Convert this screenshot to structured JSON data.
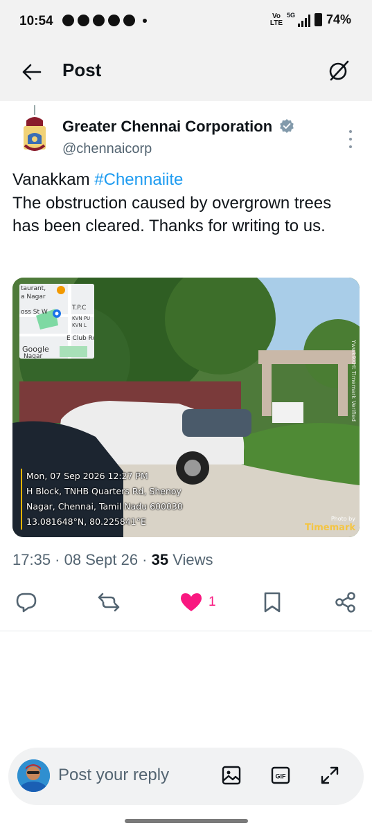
{
  "status_bar": {
    "time": "10:54",
    "network_label": "Vo LTE",
    "signal_label": "5G",
    "battery": "74%",
    "app_icons": [
      "whatsapp-icon",
      "facebook-icon",
      "facebook-icon",
      "facebook-icon",
      "messenger-icon",
      "dot-icon"
    ]
  },
  "header": {
    "title": "Post",
    "back_icon": "arrow-left-icon",
    "grok_icon": "grok-icon"
  },
  "author": {
    "name": "Greater Chennai Corporation",
    "handle": "@chennaicorp",
    "verified_icon": "verified-badge-icon",
    "more_icon": "more-vertical-icon"
  },
  "tweet": {
    "greeting": "Vanakkam ",
    "hashtag": "#Chennaiite",
    "body": "The obstruction caused by overgrown trees has been cleared. Thanks for writing to us."
  },
  "photo": {
    "map": {
      "labels": [
        "taurant,",
        "a Nagar",
        "T.P.C",
        "oss St W",
        "KVN PU",
        "KVN L",
        "E Club Rc",
        "Google",
        "Nagar"
      ]
    },
    "timestamp": "Mon, 07 Sep 2026 12:27 PM",
    "address_line1": "H Block, TNHB Quarters Rd, Shenoy",
    "address_line2": "Nagar, Chennai, Tamil Nadu 600030",
    "coordinates": "13.081648°N, 80.225841°E",
    "watermark_small": "Photo by",
    "watermark_brand": "Timemark",
    "side_text": "Ywwk9XHt   Timemark Verified"
  },
  "meta": {
    "time": "17:35",
    "separator": " · ",
    "date": "08 Sept 26",
    "views_count": "35",
    "views_label": " Views"
  },
  "actions": {
    "reply_icon": "reply-icon",
    "repost_icon": "repost-icon",
    "like_icon": "heart-filled-icon",
    "like_count": "1",
    "bookmark_icon": "bookmark-icon",
    "share_icon": "share-icon",
    "like_color": "#f91880"
  },
  "reply_bar": {
    "placeholder": "Post your reply",
    "image_icon": "image-icon",
    "gif_icon": "gif-icon",
    "gif_label": "GIF",
    "expand_icon": "expand-icon"
  },
  "colors": {
    "link": "#1d9bf0",
    "secondary_text": "#536471",
    "header_bg": "#f2f2f2"
  }
}
